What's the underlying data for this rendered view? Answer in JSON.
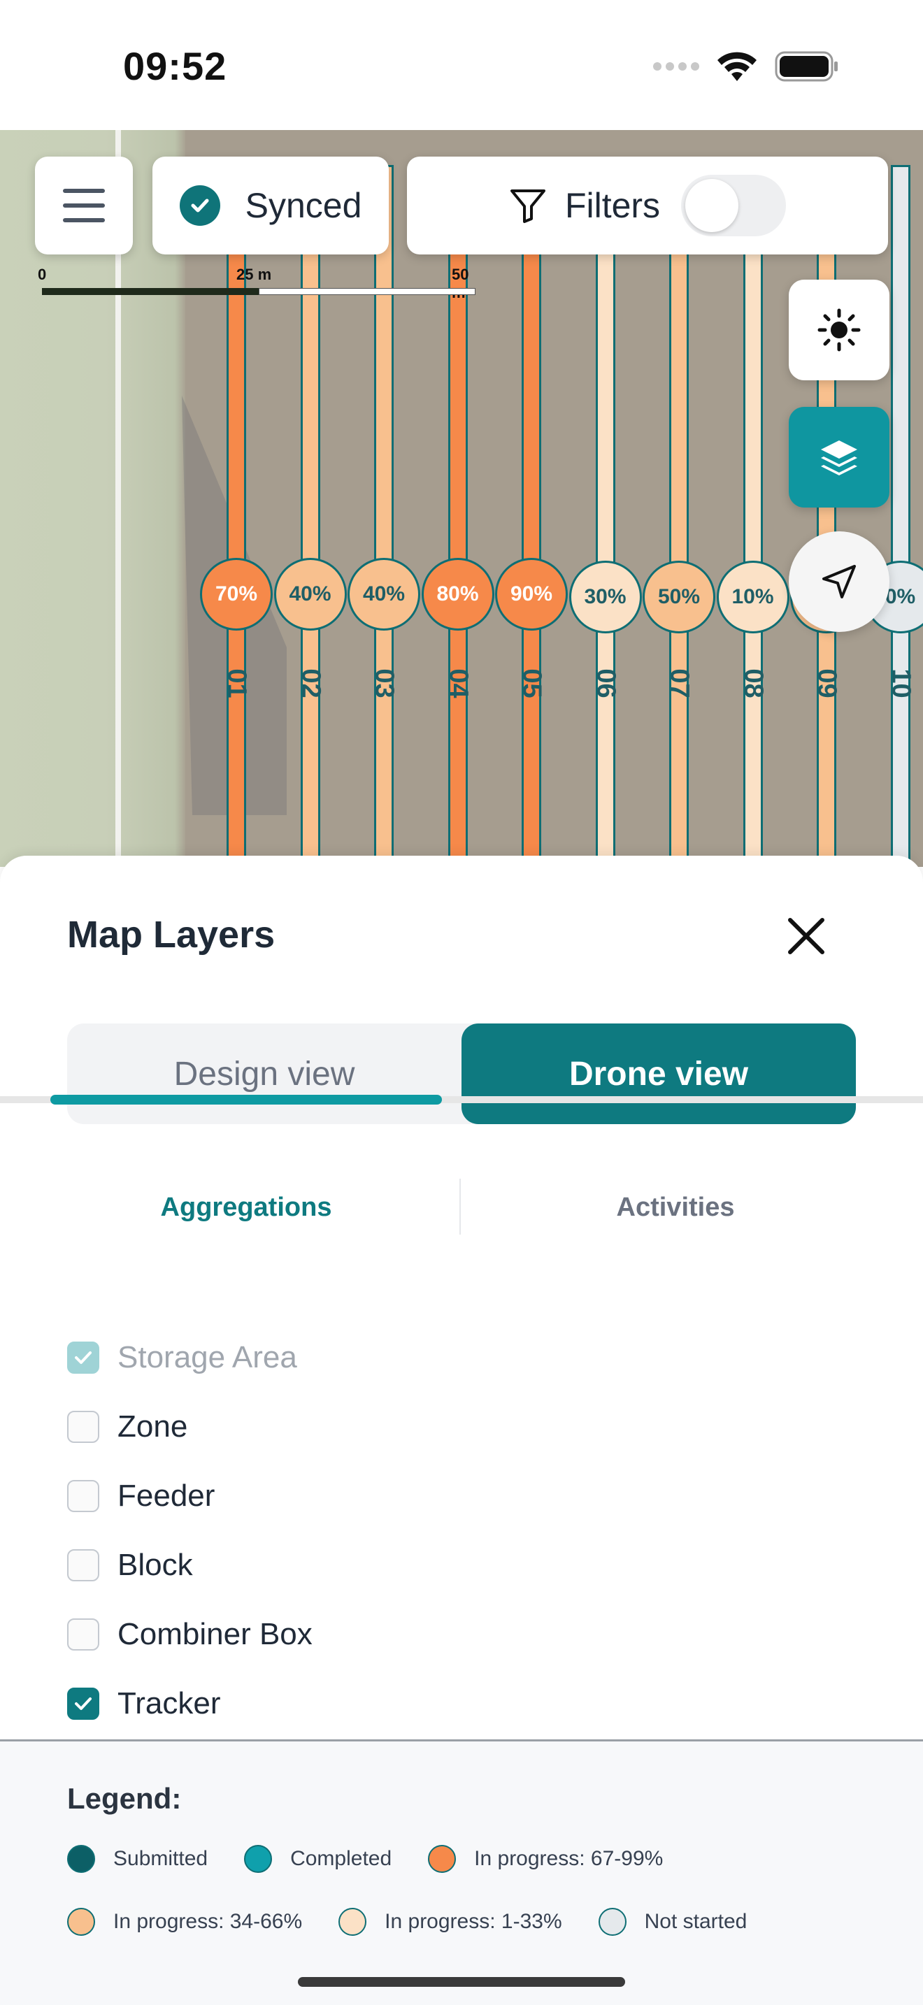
{
  "status_bar": {
    "time": "09:52"
  },
  "map": {
    "scale": {
      "labels": [
        "0",
        "25 m",
        "50 m"
      ]
    },
    "rows": [
      {
        "label": "01",
        "pct": "70%",
        "fill": "#f6894a",
        "text_color": "#ffffff"
      },
      {
        "label": "02",
        "pct": "40%",
        "fill": "#f8c08e",
        "text_color": "#1f5e66"
      },
      {
        "label": "03",
        "pct": "40%",
        "fill": "#f8c08e",
        "text_color": "#1f5e66"
      },
      {
        "label": "04",
        "pct": "80%",
        "fill": "#f6894a",
        "text_color": "#ffffff"
      },
      {
        "label": "05",
        "pct": "90%",
        "fill": "#f6894a",
        "text_color": "#ffffff"
      },
      {
        "label": "06",
        "pct": "30%",
        "fill": "#fbe1c6",
        "text_color": "#1f5e66"
      },
      {
        "label": "07",
        "pct": "50%",
        "fill": "#f8c08e",
        "text_color": "#1f5e66"
      },
      {
        "label": "08",
        "pct": "10%",
        "fill": "#fbe1c6",
        "text_color": "#1f5e66"
      },
      {
        "label": "09",
        "pct": "40%",
        "fill": "#f8c08e",
        "text_color": "#1f5e66"
      },
      {
        "label": "10",
        "pct": "0%",
        "fill": "#e5e9ec",
        "text_color": "#1f5e66"
      }
    ]
  },
  "toolbar": {
    "synced_label": "Synced",
    "filters_label": "Filters",
    "filters_enabled": false
  },
  "sheet": {
    "title": "Map Layers",
    "views": {
      "design": "Design view",
      "drone": "Drone view",
      "selected": "drone"
    },
    "tabs": {
      "aggregations": "Aggregations",
      "activities": "Activities",
      "selected": "aggregations"
    },
    "aggregations": [
      {
        "label": "Storage Area",
        "checked": true,
        "disabled": true
      },
      {
        "label": "Zone",
        "checked": false,
        "disabled": false
      },
      {
        "label": "Feeder",
        "checked": false,
        "disabled": false
      },
      {
        "label": "Block",
        "checked": false,
        "disabled": false
      },
      {
        "label": "Combiner Box",
        "checked": false,
        "disabled": false
      },
      {
        "label": "Tracker",
        "checked": true,
        "disabled": false
      }
    ],
    "legend": {
      "title": "Legend:",
      "items": [
        {
          "label": "Submitted",
          "color": "#0c5f66"
        },
        {
          "label": "Completed",
          "color": "#0fa0ac"
        },
        {
          "label": "In progress: 67-99%",
          "color": "#f6894a"
        },
        {
          "label": "In progress: 34-66%",
          "color": "#f8c08e"
        },
        {
          "label": "In progress: 1-33%",
          "color": "#fbe1c6"
        },
        {
          "label": "Not started",
          "color": "#e5e9ec"
        }
      ]
    }
  }
}
